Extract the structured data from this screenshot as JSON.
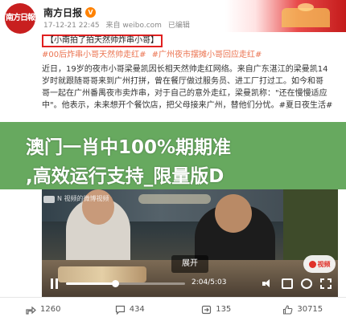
{
  "account": {
    "avatar_text": "南方日報",
    "name": "南方日报",
    "vip_badge": "V",
    "time": "17-12-21 22:45",
    "source": "来自 weibo.com",
    "edited": "已编辑"
  },
  "post": {
    "title": "【小南拍了拍天然帅炸串小哥】",
    "tags": [
      "#00后炸串小哥天然帅走红#",
      "#广州夜市摆摊小哥回应走红#"
    ],
    "body": "近日，19岁的夜市小哥梁曼凯因长相天然帅走红网络。来自广东湛江的梁曼凯14\n岁时就跟随哥哥来到广州打拼，曾在餐厅做过服务员、进工厂打过工。如今和哥\n哥一起在广州番禺夜市卖炸串，对于自己的意外走红，梁曼凯称：\"还在慢慢适应\n中\"。他表示，未来想开个餐饮店，把父母接来广州，替他们分忧。#夏日夜生活#"
  },
  "overlay": {
    "line1": "澳门一肖中100%期期准",
    "line2": ",高效运行支持_限量版D"
  },
  "video": {
    "watermark": "N 视频的微博视频",
    "expand_label": "展开",
    "badge_label": "视频",
    "time_label": "2:04/5:03",
    "progress": 0.41,
    "colors": {
      "badge_red": "#e0322a"
    }
  },
  "actions": [
    {
      "icon": "share-icon",
      "count": "1260"
    },
    {
      "icon": "comment-icon",
      "count": "434"
    },
    {
      "icon": "repost-icon",
      "count": "135"
    },
    {
      "icon": "like-icon",
      "count": "30715"
    }
  ],
  "colors": {
    "tag": "#eb7350",
    "title_box": "#e02020",
    "overlay": "#46963c",
    "brand_red": "#c81f1f"
  }
}
